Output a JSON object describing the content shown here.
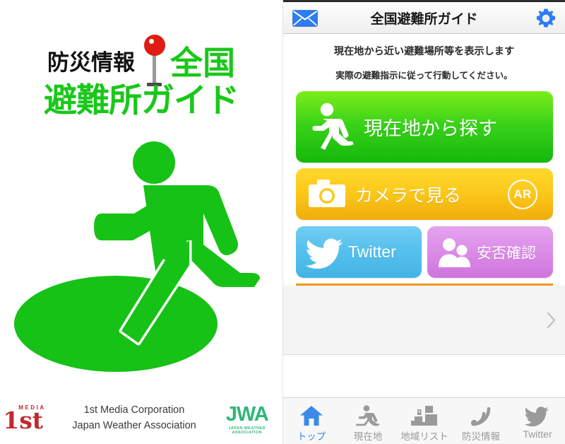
{
  "left": {
    "logo": {
      "line1_black": "防災情報",
      "line1_green": "全国",
      "line2_green": "避難所ガイド",
      "pin_icon": "map-pin-icon",
      "pictogram_icon": "running-person-evacuation-icon"
    },
    "credits": {
      "media1st_top": "MEDIA",
      "media1st_main": "1st",
      "corp_line1": "1st Media Corporation",
      "corp_line2": "Japan Weather Association",
      "jwa_main": "JWA",
      "jwa_sub": "JAPAN WEATHER ASSOCIATION"
    }
  },
  "app": {
    "header": {
      "mail_icon": "envelope-icon",
      "title": "全国避難所ガイド",
      "gear_icon": "gear-icon"
    },
    "intro": {
      "line1": "現在地から近い避難場所等を表示します",
      "line2": "実際の避難指示に従って行動してください。"
    },
    "buttons": {
      "search_current": {
        "label": "現在地から探す",
        "icon": "running-person-icon",
        "color": "#38d119"
      },
      "camera_ar": {
        "label": "カメラで見る",
        "icon": "camera-icon",
        "badge": "AR",
        "color": "#fcc91b"
      },
      "twitter": {
        "label": "Twitter",
        "icon": "twitter-bird-icon",
        "color": "#56c1ee"
      },
      "safety": {
        "label": "安否確認",
        "icon": "two-people-icon",
        "color": "#dc8ee8"
      }
    },
    "banner": {
      "chevron_icon": "chevron-right-icon"
    },
    "tabs": [
      {
        "label": "トップ",
        "icon": "home-icon",
        "active": true
      },
      {
        "label": "現在地",
        "icon": "running-person-icon",
        "active": false
      },
      {
        "label": "地域リスト",
        "icon": "buildings-icon",
        "active": false
      },
      {
        "label": "防災情報",
        "icon": "rss-icon",
        "active": false
      },
      {
        "label": "Twitter",
        "icon": "twitter-bird-icon",
        "active": false
      }
    ],
    "accent_colors": {
      "active_tab": "#3b8ae8",
      "orange_rule": "#f5941e",
      "inactive_tab": "#9a9a9a"
    }
  }
}
